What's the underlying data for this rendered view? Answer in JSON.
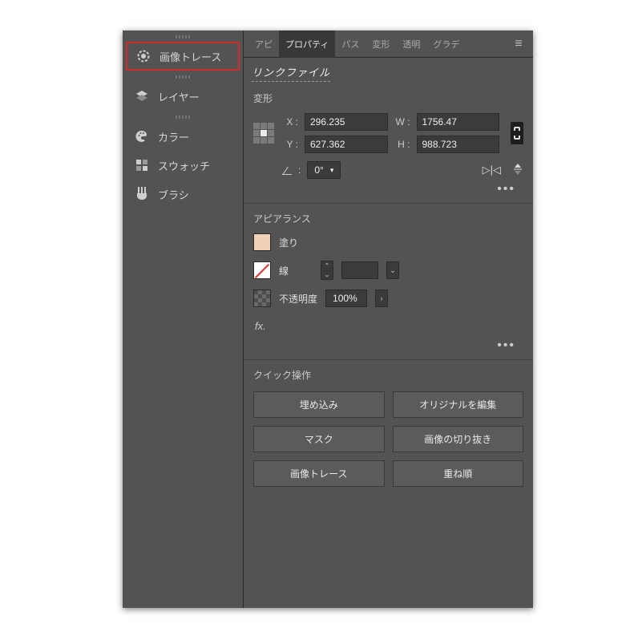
{
  "sidebar": {
    "items": [
      {
        "label": "画像トレース"
      },
      {
        "label": "レイヤー"
      },
      {
        "label": "カラー"
      },
      {
        "label": "スウォッチ"
      },
      {
        "label": "ブラシ"
      }
    ]
  },
  "tabs": {
    "items": [
      "アピ",
      "プロパティ",
      "パス",
      "変形",
      "透明",
      "グラデ"
    ],
    "active_index": 1
  },
  "link_file_title": "リンクファイル",
  "transform": {
    "heading": "変形",
    "x_label": "X :",
    "x": "296.235",
    "y_label": "Y :",
    "y": "627.362",
    "w_label": "W :",
    "w": "1756.47",
    "h_label": "H :",
    "h": "988.723",
    "angle": "0°"
  },
  "appearance": {
    "heading": "アピアランス",
    "fill_label": "塗り",
    "stroke_label": "線",
    "opacity_label": "不透明度",
    "opacity_value": "100%",
    "fx_label": "fx."
  },
  "quick": {
    "heading": "クイック操作",
    "buttons": [
      "埋め込み",
      "オリジナルを編集",
      "マスク",
      "画像の切り抜き",
      "画像トレース",
      "重ね順"
    ]
  }
}
